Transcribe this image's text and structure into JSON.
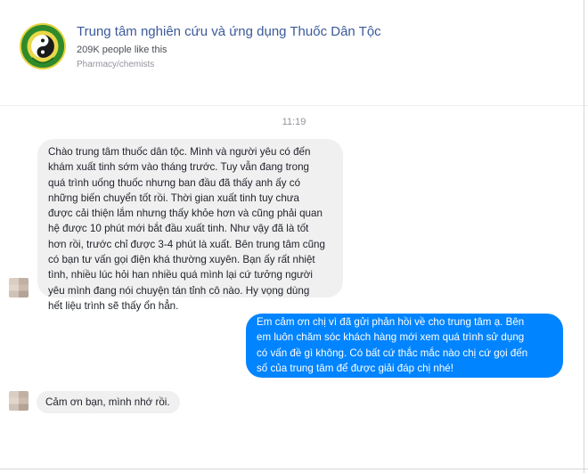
{
  "header": {
    "page_name": "Trung tâm nghiên cứu và ứng dụng Thuốc Dân Tộc",
    "likes": "209K people like this",
    "category": "Pharmacy/chemists",
    "logo_icon": "yin-yang-logo-icon"
  },
  "conversation": {
    "timestamp": "11:19",
    "messages": [
      {
        "direction": "incoming",
        "lines": [
          "Chào trung tâm thuốc dân tộc. Mình và người yêu có đến",
          "khám xuất tinh sớm vào tháng trước. Tuy vẫn đang trong",
          "quá trình uống thuốc nhưng ban đầu đã thấy anh ấy có",
          "những biến chuyển tốt rồi. Thời gian xuất tinh tuy chưa",
          "được cải thiện lắm nhưng thấy khỏe hơn và cũng phải quan",
          "hệ được 10 phút mới bắt đầu xuất tinh. Như vậy đã là tốt",
          "hơn rồi, trước chỉ được 3-4 phút là xuất. Bên trung tâm cũng",
          "có bạn tư vấn gọi điện khá thường xuyên. Bạn ấy rất nhiệt",
          "tình, nhiều lúc hỏi han nhiều quá mình lại cứ tưởng người",
          "yêu mình đang nói chuyện tán tỉnh cô nào. Hy vọng dùng",
          "hết liệu trình sẽ thấy ổn hẳn."
        ]
      },
      {
        "direction": "outgoing",
        "lines": [
          "Em cảm ơn chị vì đã gửi phản hồi về cho trung tâm ạ. Bên",
          "em luôn chăm sóc khách hàng mới xem quá trình sử dụng",
          "có vấn đề gì không. Có bất cứ thắc mắc nào chị cứ gọi đến",
          "số của trung tâm để được giải đáp chị nhé!"
        ]
      },
      {
        "direction": "incoming",
        "lines": [
          "Cảm ơn bạn, mình nhớ rồi."
        ]
      }
    ]
  },
  "colors": {
    "page_name": "#3b5a9a",
    "incoming_bubble": "#f1f0f0",
    "outgoing_bubble": "#0084ff"
  }
}
